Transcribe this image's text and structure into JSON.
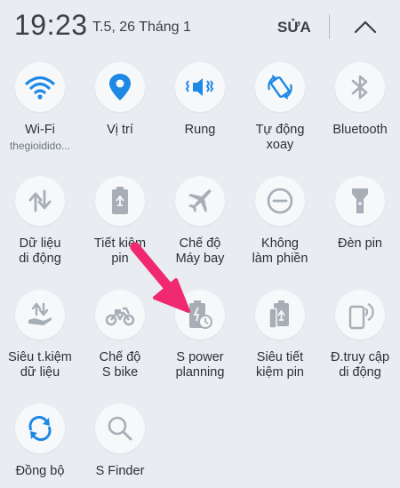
{
  "header": {
    "time": "19:23",
    "date": "T.5, 26 Tháng 1",
    "edit_label": "SỬA"
  },
  "tiles": [
    {
      "label": "Wi-Fi",
      "sub": "thegioidido...",
      "icon": "wifi-icon",
      "active": true
    },
    {
      "label": "Vị trí",
      "icon": "location-icon",
      "active": true
    },
    {
      "label": "Rung",
      "icon": "vibrate-icon",
      "active": true
    },
    {
      "label": "Tự động\nxoay",
      "icon": "auto-rotate-icon",
      "active": true
    },
    {
      "label": "Bluetooth",
      "icon": "bluetooth-icon",
      "active": false
    },
    {
      "label": "Dữ liệu\ndi động",
      "icon": "mobile-data-icon",
      "active": false
    },
    {
      "label": "Tiết kiệm\npin",
      "icon": "battery-saver-icon",
      "active": false
    },
    {
      "label": "Chế độ\nMáy bay",
      "icon": "airplane-icon",
      "active": false
    },
    {
      "label": "Không\nlàm phiền",
      "icon": "do-not-disturb-icon",
      "active": false
    },
    {
      "label": "Đèn pin",
      "icon": "flashlight-icon",
      "active": false
    },
    {
      "label": "Siêu t.kiệm\ndữ liệu",
      "icon": "data-saver-icon",
      "active": false
    },
    {
      "label": "Chế độ\nS bike",
      "icon": "s-bike-icon",
      "active": false
    },
    {
      "label": "S power\nplanning",
      "icon": "s-power-planning-icon",
      "active": false
    },
    {
      "label": "Siêu tiết\nkiệm pin",
      "icon": "ultra-power-saving-icon",
      "active": false
    },
    {
      "label": "Đ.truy cập\ndi động",
      "icon": "mobile-hotspot-icon",
      "active": false
    },
    {
      "label": "Đồng bộ",
      "icon": "sync-icon",
      "active": true
    },
    {
      "label": "S Finder",
      "icon": "search-icon",
      "active": false
    }
  ],
  "colors": {
    "active": "#1e88e5",
    "inactive": "#a7aeb6",
    "arrow": "#f0286e"
  }
}
